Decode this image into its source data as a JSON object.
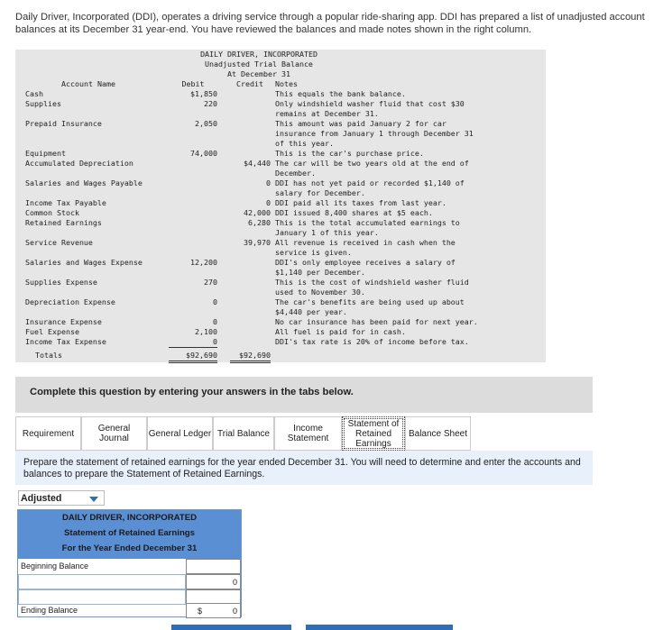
{
  "intro": "Daily Driver, Incorporated (DDI), operates a driving service through a popular ride-sharing app. DDI has prepared a list of unadjusted account balances at its December 31 year-end. You have reviewed the balances and made notes shown in the right column.",
  "trial_balance": {
    "company": "DAILY DRIVER, INCORPORATED",
    "title": "Unadjusted Trial Balance",
    "date": "At December 31",
    "headers": {
      "account": "Account Name",
      "debit": "Debit",
      "credit": "Credit",
      "notes": "Notes"
    },
    "rows": [
      {
        "account": "Cash",
        "debit": "$1,850",
        "credit": "",
        "notes": [
          "This equals the bank balance."
        ]
      },
      {
        "account": "Supplies",
        "debit": "220",
        "credit": "",
        "notes": [
          "Only windshield washer fluid that cost $30",
          "remains at December 31."
        ]
      },
      {
        "account": "Prepaid Insurance",
        "debit": "2,050",
        "credit": "",
        "notes": [
          "This amount was paid January 2 for car",
          "insurance from January 1 through December 31",
          "of this year."
        ]
      },
      {
        "account": "Equipment",
        "debit": "74,000",
        "credit": "",
        "notes": [
          "This is the car's purchase price."
        ]
      },
      {
        "account": "Accumulated Depreciation",
        "debit": "",
        "credit": "$4,440",
        "notes": [
          "The car will be two years old at the end of",
          "December."
        ]
      },
      {
        "account": "Salaries and Wages Payable",
        "debit": "",
        "credit": "0",
        "notes": [
          "DDI has not yet paid or recorded $1,140 of",
          "salary for December."
        ]
      },
      {
        "account": "Income Tax Payable",
        "debit": "",
        "credit": "0",
        "notes": [
          "DDI paid all its taxes from last year."
        ]
      },
      {
        "account": "Common Stock",
        "debit": "",
        "credit": "42,000",
        "notes": [
          "DDI issued 8,400 shares at $5 each."
        ]
      },
      {
        "account": "Retained Earnings",
        "debit": "",
        "credit": "6,280",
        "notes": [
          "This is the total accumulated earnings to",
          "January 1 of this year."
        ]
      },
      {
        "account": "Service Revenue",
        "debit": "",
        "credit": "39,970",
        "notes": [
          "All revenue is received in cash when the",
          "service is given."
        ]
      },
      {
        "account": "Salaries and Wages Expense",
        "debit": "12,200",
        "credit": "",
        "notes": [
          "DDI's only employee receives a salary of",
          "$1,140 per December."
        ]
      },
      {
        "account": "Supplies Expense",
        "debit": "270",
        "credit": "",
        "notes": [
          "This is the cost of windshield washer fluid",
          "used to November 30."
        ]
      },
      {
        "account": "Depreciation Expense",
        "debit": "0",
        "credit": "",
        "notes": [
          "The car's benefits are being used up about",
          "$4,440 per year."
        ]
      },
      {
        "account": "Insurance Expense",
        "debit": "0",
        "credit": "",
        "notes": [
          "No car insurance has been paid for next year."
        ]
      },
      {
        "account": "Fuel Expense",
        "debit": "2,100",
        "credit": "",
        "notes": [
          "All fuel is paid for in cash."
        ]
      },
      {
        "account": "Income Tax Expense",
        "debit": "0",
        "credit": "",
        "notes": [
          "DDI's tax rate is 20% of income before tax."
        ]
      }
    ],
    "totals": {
      "label": "Totals",
      "debit": "$92,690",
      "credit": "$92,690"
    }
  },
  "instructions": "Complete this question by entering your answers in the tabs below.",
  "tabs": [
    {
      "label": "Requirement",
      "active": false
    },
    {
      "label": "General Journal",
      "active": false
    },
    {
      "label": "General Ledger",
      "active": false
    },
    {
      "label": "Trial Balance",
      "active": false
    },
    {
      "label": "Income Statement",
      "active": false
    },
    {
      "label": "Statement of Retained Earnings",
      "active": true
    },
    {
      "label": "Balance Sheet",
      "active": false
    }
  ],
  "prompt": "Prepare the statement of retained earnings for the year ended December 31. You will need to determine and enter the accounts and balances to prepare the Statement of Retained Earnings.",
  "dropdown": {
    "selected": "Adjusted"
  },
  "statement": {
    "company": "DAILY DRIVER, INCORPORATED",
    "title": "Statement of Retained Earnings",
    "period": "For the Year Ended December 31",
    "beginning_label": "Beginning Balance",
    "subtotal_value": "0",
    "ending_label": "Ending Balance",
    "currency": "$",
    "ending_value": "0"
  },
  "colors": {
    "header_blue": "#5b8fd3",
    "accent_blue": "#2f6db4",
    "prompt_bg": "#e8f1fb"
  }
}
